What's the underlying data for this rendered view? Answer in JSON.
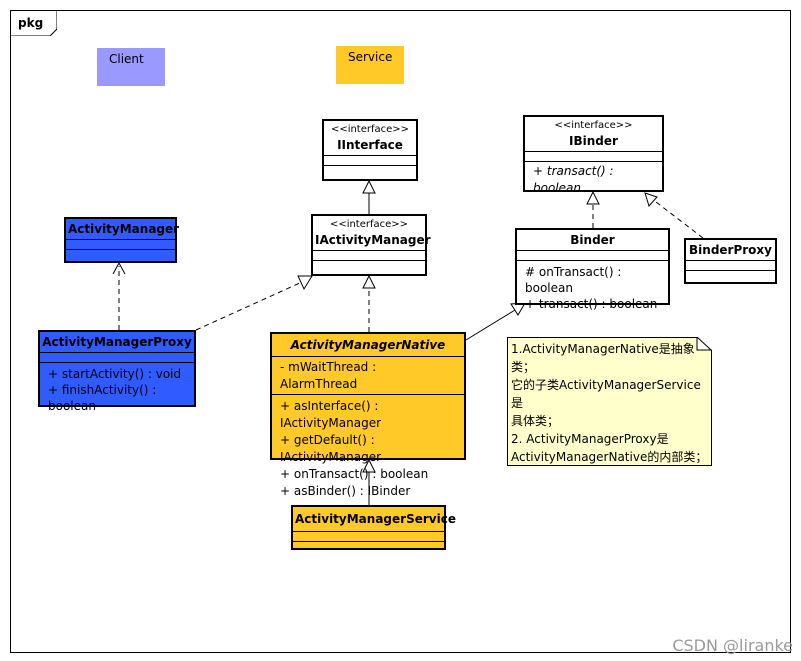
{
  "package": {
    "label": "pkg"
  },
  "legend": [
    {
      "label": "Client",
      "color": "#9999FF"
    },
    {
      "label": "Service",
      "color": "#FFC928"
    }
  ],
  "classes": {
    "iinterface": {
      "stereotype": "<<interface>>",
      "name": "IInterface"
    },
    "iactivitymanager": {
      "stereotype": "<<interface>>",
      "name": "IActivityManager"
    },
    "ibinder": {
      "stereotype": "<<interface>>",
      "name": "IBinder",
      "operations": [
        "+ transact() : boolean"
      ]
    },
    "binder": {
      "name": "Binder",
      "operations": [
        "# onTransact() : boolean",
        "+ transact() : boolean"
      ]
    },
    "binderproxy": {
      "name": "BinderProxy"
    },
    "activitymanager": {
      "name": "ActivityManager"
    },
    "activitymanagerproxy": {
      "name": "ActivityManagerProxy",
      "operations": [
        "+ startActivity() : void",
        "+ finishActivity() : boolean"
      ]
    },
    "activitymanagernative": {
      "name": "ActivityManagerNative",
      "attributes": [
        "- mWaitThread : AlarmThread"
      ],
      "operations": [
        "+ asInterface() : IActivityManager",
        "+ getDefault() : IActivityManager",
        "+ onTransact() : boolean",
        "+ asBinder() : IBinder"
      ]
    },
    "activitymanagerservice": {
      "name": "ActivityManagerService"
    }
  },
  "note": {
    "lines": [
      "1.ActivityManagerNative是抽象类；",
      "它的子类ActivityManagerService是",
      "具体类；",
      "2. ActivityManagerProxy是",
      "ActivityManagerNative的内部类；"
    ]
  },
  "watermark": "CSDN @liranke",
  "colors": {
    "client_blue": "#2F5BFF",
    "service_yellow": "#FFC928",
    "note_bg": "#FFFFCC"
  }
}
